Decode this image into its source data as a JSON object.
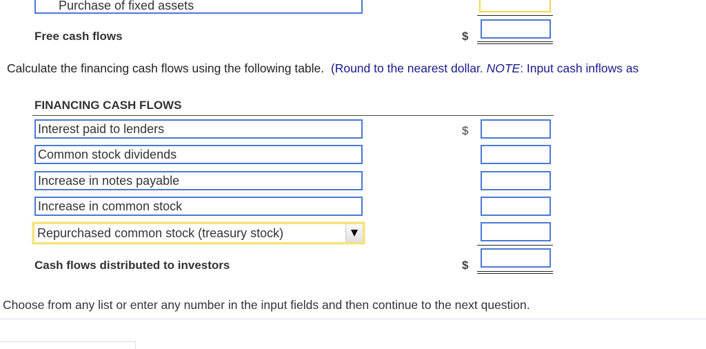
{
  "top_section": {
    "partial_row_label": "Purchase of fixed assets",
    "free_cash_flows_label": "Free cash flows",
    "currency_symbol": "$"
  },
  "instruction": {
    "main": "Calculate the financing cash flows using the following table.",
    "note_open": "(Round to the nearest dollar. ",
    "note_italic": "NOTE",
    "note_rest": ": Input cash inflows as"
  },
  "financing": {
    "heading": "FINANCING CASH FLOWS",
    "rows": [
      {
        "label": "Interest paid to lenders",
        "value": "",
        "show_currency": true
      },
      {
        "label": "Common stock dividends",
        "value": "",
        "show_currency": false
      },
      {
        "label": "Increase in notes payable",
        "value": "",
        "show_currency": false
      },
      {
        "label": "Increase in common stock",
        "value": "",
        "show_currency": false
      }
    ],
    "dropdown_row": {
      "selected": "Repurchased common stock (treasury stock)",
      "value": ""
    },
    "total_label": "Cash flows distributed to investors",
    "currency_symbol": "$"
  },
  "footer": {
    "text": "Choose from any list or enter any number in the input fields and then continue to the next question."
  }
}
